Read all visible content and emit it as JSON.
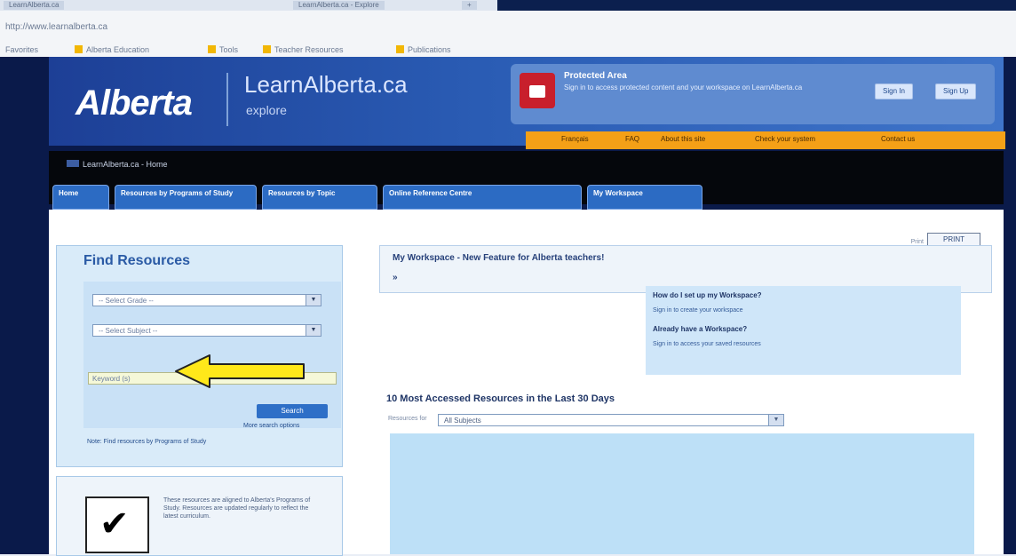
{
  "browser": {
    "tabs": [
      "LearnAlberta.ca",
      "LearnAlberta.ca - Explore",
      "+"
    ],
    "address": "http://www.learnalberta.ca",
    "favorites": [
      "Favorites",
      "Alberta Education",
      "Tools",
      "Teacher Resources",
      "Publications"
    ]
  },
  "banner": {
    "logo_text": "Alberta",
    "site_title": "LearnAlberta.ca",
    "site_subtitle": "explore",
    "signin_title": "Protected Area",
    "signin_desc": "Sign in to access protected content and your workspace on LearnAlberta.ca",
    "signin_button": "Sign In",
    "signup_button": "Sign Up",
    "top_links": [
      "Français",
      "FAQ",
      "About this site",
      "Check your system",
      "Contact us"
    ]
  },
  "nav": {
    "brand": "LearnAlberta.ca - Home",
    "tabs": [
      {
        "label": "Home"
      },
      {
        "label": "Resources by Programs of Study"
      },
      {
        "label": "Resources by Topic"
      },
      {
        "label": "Online Reference Centre"
      },
      {
        "label": "My Workspace"
      }
    ]
  },
  "content": {
    "print_label": "Print",
    "print_button": "PRINT",
    "find": {
      "title": "Find Resources",
      "grade_placeholder": "-- Select Grade --",
      "subject_placeholder": "-- Select Subject --",
      "keyword_placeholder": "Keyword (s)",
      "go_button": "Search",
      "advanced_link": "More search options",
      "note": "Note: Find resources by Programs of Study"
    },
    "checklist_text": "These resources are aligned to Alberta's Programs of Study. Resources are updated regularly to reflect the latest curriculum.",
    "workspace": {
      "title": "My Workspace - New Feature for Alberta teachers!",
      "link": "»"
    },
    "info": {
      "q1": "How do I set up my Workspace?",
      "a1": "Sign in to create your workspace",
      "q2": "Already have a Workspace?",
      "a2": "Sign in to access your saved resources"
    },
    "most_accessed_title": "10 Most Accessed Resources in the Last 30 Days",
    "filter_label": "Resources for",
    "filter_value": "All Subjects"
  }
}
